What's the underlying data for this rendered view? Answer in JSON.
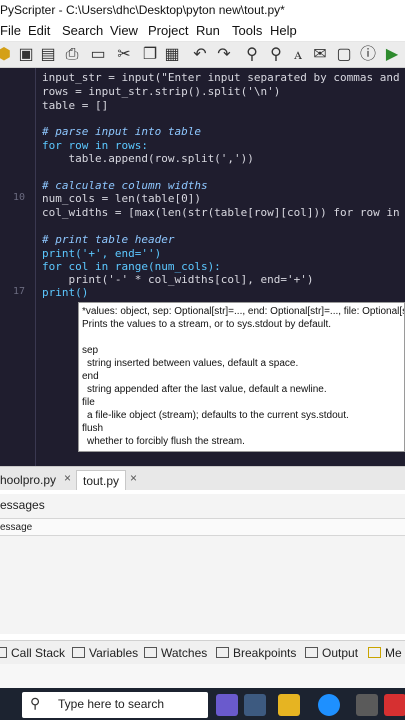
{
  "titlebar": {
    "title": "PyScripter - C:\\Users\\dhc\\Desktop\\pyton new\\tout.py*"
  },
  "menu": [
    "File",
    "Edit",
    "Search",
    "View",
    "Project",
    "Run",
    "Tools",
    "Help"
  ],
  "toolbar": {
    "icons": [
      "python-icon",
      "save-icon",
      "save-all-icon",
      "print-icon",
      "cut-icon",
      "copy-icon",
      "paste-icon",
      "undo-icon",
      "redo-icon",
      "find-icon",
      "find-next-icon",
      "replace-icon",
      "bookmark-icon",
      "run-icon",
      "info-icon",
      "play-icon"
    ]
  },
  "editor": {
    "line_numbers": [
      "10",
      "17"
    ],
    "lines": [
      "input_str = input(\"Enter input separated by commas and lines",
      "rows = input_str.strip().split('\\n')",
      "table = []",
      "",
      "# parse input into table",
      "for row in rows:",
      "    table.append(row.split(','))",
      "",
      "# calculate column widths",
      "num_cols = len(table[0])",
      "col_widths = [max(len(str(table[row][col])) for row in range",
      "",
      "# print table header",
      "print('+', end='')",
      "for col in range(num_cols):",
      "    print('-' * col_widths[col], end='+')",
      "print()"
    ]
  },
  "hint": {
    "signature": "*values: object, sep: Optional[str]=..., end: Optional[str]=..., file: Optional[str",
    "signature_bold": "*values: object",
    "summary": "Prints the values to a stream, or to sys.stdout by default.",
    "params": [
      {
        "name": "sep",
        "desc": "string inserted between values, default a space."
      },
      {
        "name": "end",
        "desc": "string appended after the last value, default a newline."
      },
      {
        "name": "file",
        "desc": "a file-like object (stream); defaults to the current sys.stdout."
      },
      {
        "name": "flush",
        "desc": "whether to forcibly flush the stream."
      }
    ]
  },
  "tabs": {
    "tab1": "hoolpro.py",
    "tab2": "tout.py",
    "close": "×"
  },
  "messages": {
    "title": "essages",
    "column": "essage"
  },
  "bottom_tabs": [
    "Call Stack",
    "Variables",
    "Watches",
    "Breakpoints",
    "Output",
    "Me"
  ],
  "taskbar": {
    "search_placeholder": "Type here to search"
  }
}
